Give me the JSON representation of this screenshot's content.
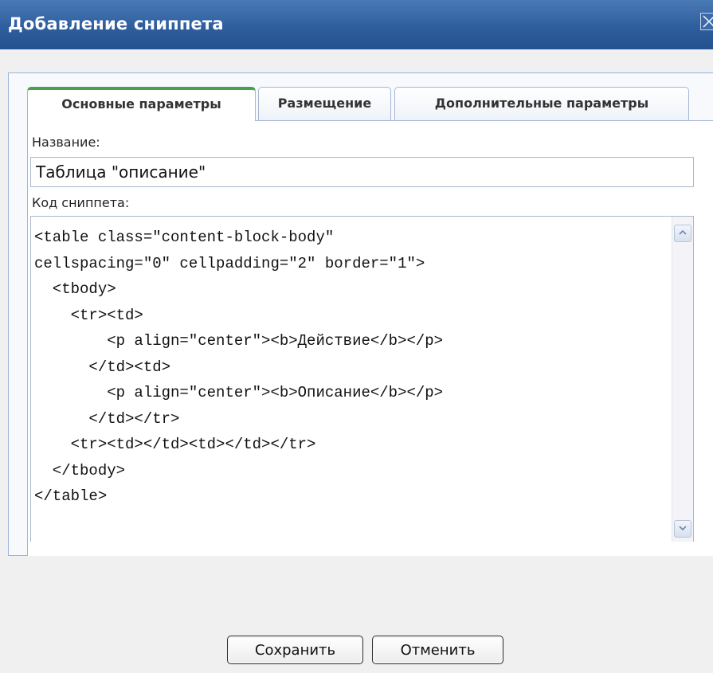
{
  "dialog": {
    "title": "Добавление сниппета"
  },
  "tabs": [
    {
      "label": "Основные параметры",
      "active": true
    },
    {
      "label": "Размещение",
      "active": false
    },
    {
      "label": "Дополнительные параметры",
      "active": false
    }
  ],
  "form": {
    "name_label": "Название:",
    "name_value": "Таблица \"описание\"",
    "code_label": "Код сниппета:",
    "code_value": "<table class=\"content-block-body\"\ncellspacing=\"0\" cellpadding=\"2\" border=\"1\">\n  <tbody>\n    <tr><td>\n        <p align=\"center\"><b>Действие</b></p>\n      </td><td>\n        <p align=\"center\"><b>Описание</b></p>\n      </td></tr>\n    <tr><td></td><td></td></tr>\n  </tbody>\n</table>"
  },
  "buttons": {
    "save_label": "Сохранить",
    "cancel_label": "Отменить"
  },
  "icons": {
    "close": "close-icon",
    "scroll_up": "chevron-up-icon",
    "scroll_down": "chevron-down-icon"
  },
  "colors": {
    "titlebar": "#2f5e9e",
    "active_tab_accent": "#49a04e",
    "panel_border": "#9bb3d8"
  }
}
